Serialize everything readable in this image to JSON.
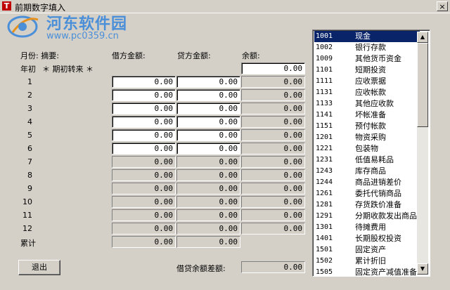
{
  "window": {
    "title": "前期数字填入",
    "close_glyph": "×",
    "app_icon_letter": "T"
  },
  "watermark": {
    "name": "河东软件园",
    "url": "www.pc0359.cn"
  },
  "headers": {
    "month_summary": "月份: 摘要:",
    "debit": "借方金额:",
    "credit": "贷方金额:",
    "balance": "余额:"
  },
  "opening": {
    "label": "年初",
    "summary": "＊ 期初转来 ＊",
    "balance": "0.00"
  },
  "months": [
    {
      "label": "1",
      "debit": "0.00",
      "credit": "0.00",
      "balance": "0.00"
    },
    {
      "label": "2",
      "debit": "0.00",
      "credit": "0.00",
      "balance": "0.00"
    },
    {
      "label": "3",
      "debit": "0.00",
      "credit": "0.00",
      "balance": "0.00"
    },
    {
      "label": "4",
      "debit": "0.00",
      "credit": "0.00",
      "balance": "0.00"
    },
    {
      "label": "5",
      "debit": "0.00",
      "credit": "0.00",
      "balance": "0.00"
    },
    {
      "label": "6",
      "debit": "0.00",
      "credit": "0.00",
      "balance": "0.00"
    },
    {
      "label": "7",
      "debit": "0.00",
      "credit": "0.00",
      "balance": "0.00"
    },
    {
      "label": "8",
      "debit": "0.00",
      "credit": "0.00",
      "balance": "0.00"
    },
    {
      "label": "9",
      "debit": "0.00",
      "credit": "0.00",
      "balance": "0.00"
    },
    {
      "label": "10",
      "debit": "0.00",
      "credit": "0.00",
      "balance": "0.00"
    },
    {
      "label": "11",
      "debit": "0.00",
      "credit": "0.00",
      "balance": "0.00"
    },
    {
      "label": "12",
      "debit": "0.00",
      "credit": "0.00",
      "balance": "0.00"
    }
  ],
  "totals": {
    "label": "累计",
    "debit": "0.00",
    "credit": "0.00"
  },
  "exit_button": "退出",
  "difference": {
    "label": "借贷余额差额:",
    "value": "0.00"
  },
  "accounts": [
    {
      "code": "1001",
      "name": "现金"
    },
    {
      "code": "1002",
      "name": "银行存款"
    },
    {
      "code": "1009",
      "name": "其他货币资金"
    },
    {
      "code": "1101",
      "name": "短期投资"
    },
    {
      "code": "1111",
      "name": "应收票据"
    },
    {
      "code": "1131",
      "name": "应收帐款"
    },
    {
      "code": "1133",
      "name": "其他应收款"
    },
    {
      "code": "1141",
      "name": "坏帐准备"
    },
    {
      "code": "1151",
      "name": "预付帐款"
    },
    {
      "code": "1201",
      "name": "物资采购"
    },
    {
      "code": "1221",
      "name": "包装物"
    },
    {
      "code": "1231",
      "name": "低值易耗品"
    },
    {
      "code": "1243",
      "name": "库存商品"
    },
    {
      "code": "1244",
      "name": "商品进销差价"
    },
    {
      "code": "1261",
      "name": "委托代销商品"
    },
    {
      "code": "1281",
      "name": "存货跌价准备"
    },
    {
      "code": "1291",
      "name": "分期收款发出商品"
    },
    {
      "code": "1301",
      "name": "待摊费用"
    },
    {
      "code": "1401",
      "name": "长期股权投资"
    },
    {
      "code": "1501",
      "name": "固定资产"
    },
    {
      "code": "1502",
      "name": "累计折旧"
    },
    {
      "code": "1505",
      "name": "固定资产减值准备"
    }
  ],
  "selected_account": "1001",
  "colors": {
    "selection": "#0a246a",
    "face": "#d4d0c8",
    "brand": "#4a8fd8",
    "icon": "#c00000"
  },
  "icons": {
    "close": "close-icon",
    "scroll_up": "arrow-up-icon",
    "scroll_down": "arrow-down-icon"
  }
}
